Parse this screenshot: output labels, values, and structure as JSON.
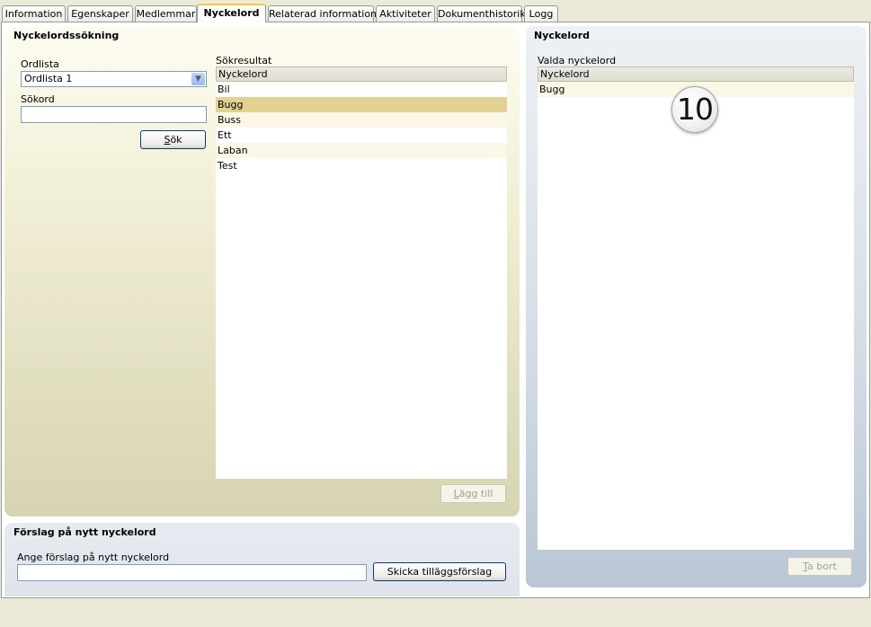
{
  "tabs": [
    "Information",
    "Egenskaper",
    "Medlemmar",
    "Nyckelord",
    "Relaterad information",
    "Aktiviteter",
    "Dokumenthistorik",
    "Logg"
  ],
  "active_tab": "Nyckelord",
  "search_panel": {
    "title": "Nyckelordssökning",
    "ordlista_label": "Ordlista",
    "ordlista_value": "Ordlista 1",
    "sokord_label": "Sökord",
    "sokord_value": "",
    "search_button": "Sök",
    "search_button_access_key": "S",
    "search_button_rest": "ök",
    "results_label": "Sökresultat",
    "results_header": "Nyckelord",
    "results": [
      "Bil",
      "Bugg",
      "Buss",
      "Ett",
      "Laban",
      "Test"
    ],
    "selected_result": "Bugg",
    "add_button_access_key": "L",
    "add_button_rest": "ägg till"
  },
  "suggest_panel": {
    "title": "Förslag på nytt nyckelord",
    "input_label": "Ange förslag på nytt nyckelord",
    "input_value": "",
    "submit_button": "Skicka tilläggsförslag"
  },
  "keyword_panel": {
    "title": "Nyckelord",
    "selected_label": "Valda nyckelord",
    "header": "Nyckelord",
    "items": [
      "Bugg"
    ],
    "remove_button_access_key": "T",
    "remove_button_rest": "a bort"
  },
  "step_badge": "10"
}
